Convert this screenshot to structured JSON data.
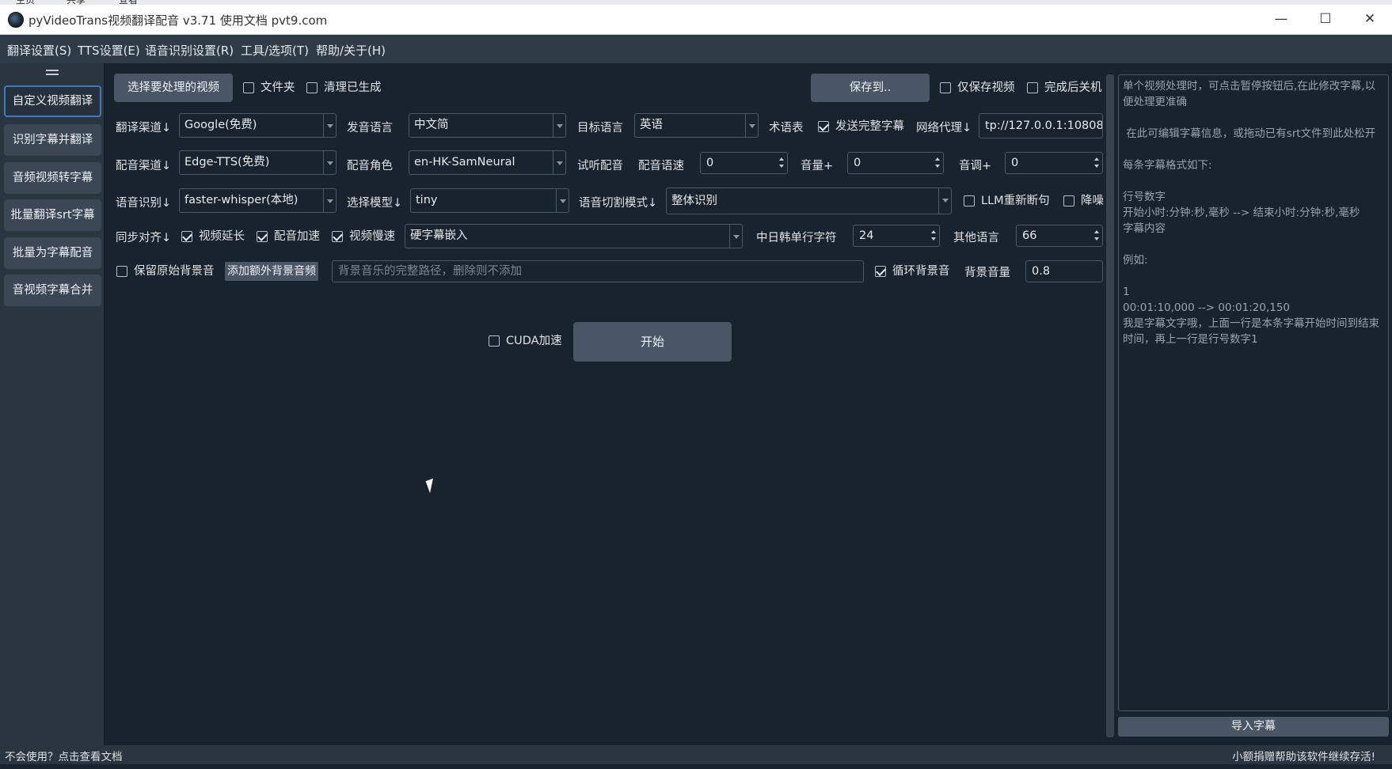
{
  "window": {
    "title": "pyVideoTrans视频翻译配音 v3.71  使用文档  pvt9.com"
  },
  "topstrip": [
    "主页",
    "共享",
    "查看"
  ],
  "menu": [
    "翻译设置(S)",
    "TTS设置(E)",
    "语音识别设置(R)",
    "工具/选项(T)",
    "帮助/关于(H)"
  ],
  "sidebar": {
    "items": [
      {
        "label": "自定义视频翻译",
        "active": true
      },
      {
        "label": "识别字幕并翻译",
        "active": false
      },
      {
        "label": "音频视频转字幕",
        "active": false
      },
      {
        "label": "批量翻译srt字幕",
        "active": false
      },
      {
        "label": "批量为字幕配音",
        "active": false
      },
      {
        "label": "音视频字幕合并",
        "active": false
      }
    ]
  },
  "row1": {
    "select_video": "选择要处理的视频",
    "folder": {
      "label": "文件夹",
      "checked": false
    },
    "clean": {
      "label": "清理已生成",
      "checked": false
    },
    "save_to": "保存到..",
    "only_video": {
      "label": "仅保存视频",
      "checked": false
    },
    "shutdown": {
      "label": "完成后关机",
      "checked": false
    }
  },
  "row2": {
    "trans_channel_label": "翻译渠道↓",
    "trans_channel_value": "Google(免费)",
    "src_lang_label": "发音语言",
    "src_lang_value": "中文简",
    "target_lang_label": "目标语言",
    "target_lang_value": "英语",
    "glossary_label": "术语表",
    "send_full": {
      "label": "发送完整字幕",
      "checked": true
    },
    "proxy_label": "网络代理↓",
    "proxy_value": "tp://127.0.0.1:10808"
  },
  "row3": {
    "tts_channel_label": "配音渠道↓",
    "tts_channel_value": "Edge-TTS(免费)",
    "voice_label": "配音角色",
    "voice_value": "en-HK-SamNeural",
    "preview_label": "试听配音",
    "speed_label": "配音语速",
    "speed_value": "0",
    "volume_label": "音量+",
    "volume_value": "0",
    "pitch_label": "音调+",
    "pitch_value": "0"
  },
  "row4": {
    "asr_label": "语音识别↓",
    "asr_value": "faster-whisper(本地)",
    "model_label": "选择模型↓",
    "model_value": "tiny",
    "split_label": "语音切割模式↓",
    "split_value": "整体识别",
    "llm_resplit": {
      "label": "LLM重新断句",
      "checked": false
    },
    "denoise": {
      "label": "降噪",
      "checked": false
    }
  },
  "row5": {
    "sync_label": "同步对齐↓",
    "video_extend": {
      "label": "视频延长",
      "checked": true
    },
    "audio_speedup": {
      "label": "配音加速",
      "checked": true
    },
    "video_slowdown": {
      "label": "视频慢速",
      "checked": true
    },
    "subtitle_mode": "硬字幕嵌入",
    "cjk_chars_label": "中日韩单行字符",
    "cjk_chars_value": "24",
    "other_lang_label": "其他语言",
    "other_lang_value": "66"
  },
  "row6": {
    "keep_bg": {
      "label": "保留原始背景音",
      "checked": false
    },
    "add_bg_button": "添加额外背景音频",
    "bg_path_placeholder": "背景音乐的完整路径，删除则不添加",
    "loop_bg": {
      "label": "循环背景音",
      "checked": true
    },
    "bg_volume_label": "背景音量",
    "bg_volume_value": "0.8"
  },
  "action": {
    "cuda": {
      "label": "CUDA加速",
      "checked": false
    },
    "start": "开始"
  },
  "subtitle_panel": {
    "lines": [
      "单个视频处理时，可点击暂停按钮后,在此修改字幕,以便处理更准确",
      "",
      " 在此可编辑字幕信息，或拖动已有srt文件到此处松开",
      "",
      "每条字幕格式如下:",
      "",
      "行号数字",
      "开始小时:分钟:秒,毫秒 --> 结束小时:分钟:秒,毫秒",
      "字幕内容",
      "",
      "例如:",
      "",
      "1",
      "00:01:10,000 --> 00:01:20,150",
      "我是字幕文字哦，上面一行是本条字幕开始时间到结束时间，再上一行是行号数字1"
    ],
    "import_button": "导入字幕"
  },
  "status": {
    "left": "不会使用？点击查看文档",
    "right": "小额捐赠帮助该软件继续存活!"
  }
}
